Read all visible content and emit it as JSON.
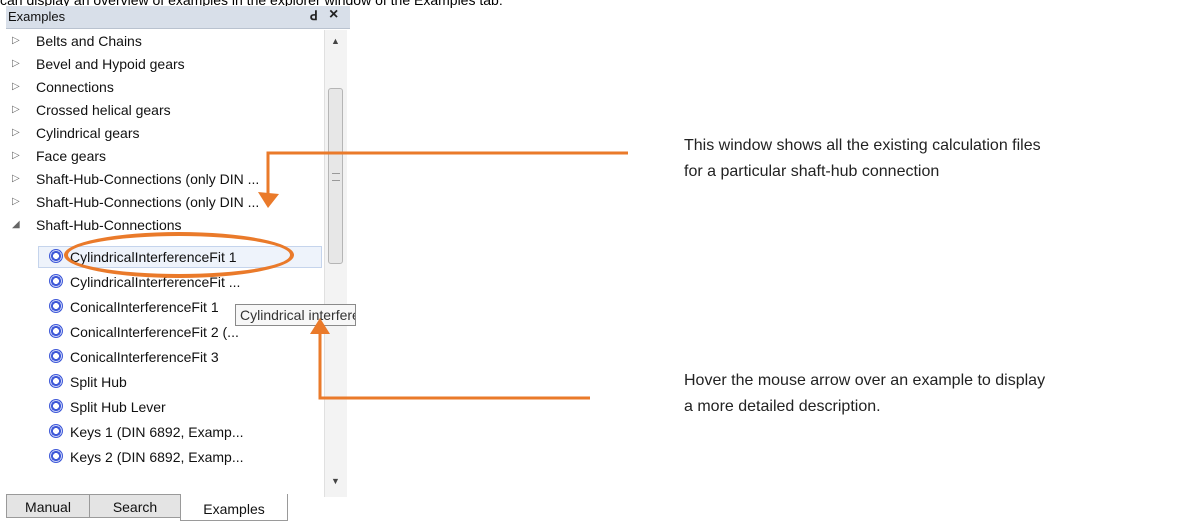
{
  "top_text": "can display an overview of examples in the explorer window of the Examples tab:",
  "panel": {
    "title": "Examples",
    "float_glyph": "ꓒ",
    "close_glyph": "×",
    "categories": [
      {
        "label": "Belts and Chains",
        "caret": "▷"
      },
      {
        "label": "Bevel and Hypoid gears",
        "caret": "▷"
      },
      {
        "label": "Connections",
        "caret": "▷"
      },
      {
        "label": "Crossed helical gears",
        "caret": "▷"
      },
      {
        "label": "Cylindrical gears",
        "caret": "▷"
      },
      {
        "label": "Face gears",
        "caret": "▷"
      },
      {
        "label": "Shaft-Hub-Connections (only DIN ...",
        "caret": "▷"
      },
      {
        "label": "Shaft-Hub-Connections (only DIN ...",
        "caret": "▷"
      },
      {
        "label": "Shaft-Hub-Connections",
        "caret": "◢"
      }
    ],
    "examples": [
      "CylindricalInterferenceFit 1",
      "CylindricalInterferenceFit ...",
      "ConicalInterferenceFit 1",
      "ConicalInterferenceFit 2 (...",
      "ConicalInterferenceFit 3",
      "Split Hub",
      "Split Hub Lever",
      "Keys 1 (DIN 6892, Examp...",
      "Keys 2 (DIN 6892, Examp..."
    ],
    "tooltip": "Cylindrical interference fit",
    "scrollbar": {
      "up": "▲",
      "down": "▼"
    },
    "tabs": [
      {
        "label": "Manual",
        "active": false
      },
      {
        "label": "Search",
        "active": false
      },
      {
        "label": "Examples",
        "active": true
      }
    ]
  },
  "annotations": {
    "note_top": "This window shows all the existing calculation files\nfor a particular shaft-hub connection",
    "note_bottom": "Hover the mouse arrow over an example to display\na more detailed description."
  },
  "colors": {
    "accent_orange": "#ea7a2a",
    "icon_blue": "#3f59d8",
    "titlebar": "#d8dfe9"
  }
}
